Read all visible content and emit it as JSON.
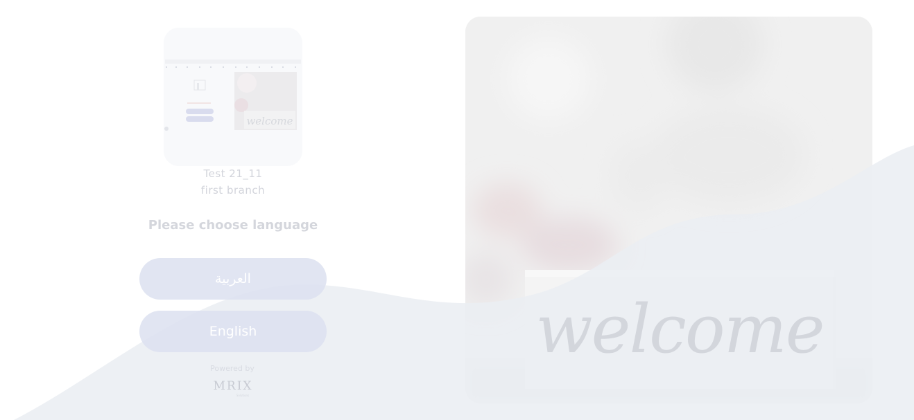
{
  "branding": {
    "company_name": "Test 21_11",
    "branch_name": "first branch",
    "logo_image": "restaurant-logo-thumbnail",
    "powered_by_label": "Powered by",
    "powered_by_brand": "MRIX",
    "powered_by_tagline": "Solutions"
  },
  "language_selector": {
    "prompt": "Please choose language",
    "options": [
      {
        "label": "العربية",
        "code": "ar"
      },
      {
        "label": "English",
        "code": "en"
      }
    ]
  },
  "hero": {
    "image": "welcome-sign-photo",
    "sign_text": "welcome"
  },
  "logo_thumbnail": {
    "sign_text": "welcome"
  },
  "colors": {
    "accent": "#dce0f0",
    "wave": "#eef1f5",
    "text_muted": "#d2d4db"
  }
}
